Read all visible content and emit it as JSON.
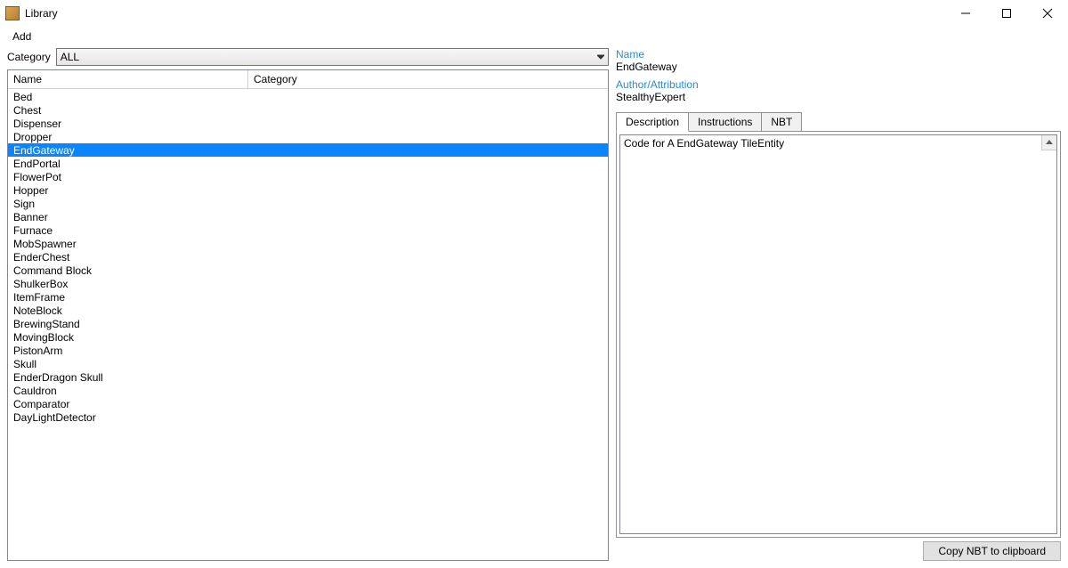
{
  "window": {
    "title": "Library"
  },
  "menubar": {
    "add": "Add"
  },
  "filter": {
    "label": "Category",
    "value": "ALL"
  },
  "list": {
    "headers": {
      "name": "Name",
      "category": "Category"
    },
    "selected_index": 4,
    "items": [
      {
        "name": "Bed"
      },
      {
        "name": "Chest"
      },
      {
        "name": "Dispenser"
      },
      {
        "name": "Dropper"
      },
      {
        "name": "EndGateway"
      },
      {
        "name": "EndPortal"
      },
      {
        "name": "FlowerPot"
      },
      {
        "name": "Hopper"
      },
      {
        "name": "Sign"
      },
      {
        "name": "Banner"
      },
      {
        "name": "Furnace"
      },
      {
        "name": "MobSpawner"
      },
      {
        "name": "EnderChest"
      },
      {
        "name": "Command Block"
      },
      {
        "name": "ShulkerBox"
      },
      {
        "name": "ItemFrame"
      },
      {
        "name": "NoteBlock"
      },
      {
        "name": "BrewingStand"
      },
      {
        "name": "MovingBlock"
      },
      {
        "name": "PistonArm"
      },
      {
        "name": "Skull"
      },
      {
        "name": "EnderDragon Skull"
      },
      {
        "name": "Cauldron"
      },
      {
        "name": "Comparator"
      },
      {
        "name": "DayLightDetector"
      }
    ]
  },
  "details": {
    "name_label": "Name",
    "name_value": "EndGateway",
    "author_label": "Author/Attribution",
    "author_value": "StealthyExpert",
    "tabs": {
      "description": "Description",
      "instructions": "Instructions",
      "nbt": "NBT"
    },
    "description_text": "Code for A EndGateway TileEntity",
    "copy_button": "Copy NBT to clipboard"
  }
}
